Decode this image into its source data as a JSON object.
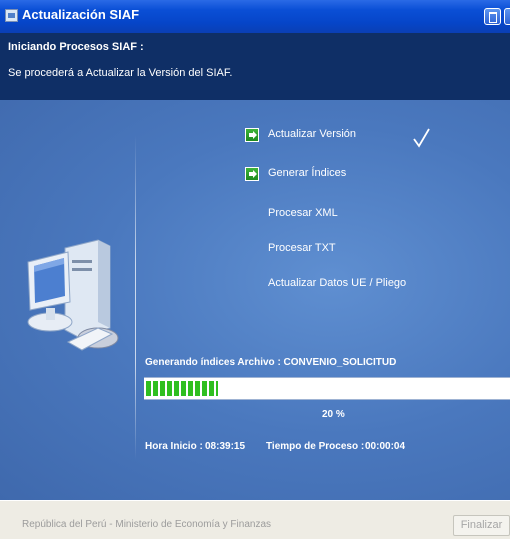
{
  "window": {
    "title": "Actualización SIAF",
    "app_icon": "siaf-app-icon"
  },
  "header": {
    "title": "Iniciando Procesos SIAF :",
    "subtitle": "Se procederá a Actualizar la Versión del SIAF."
  },
  "steps": [
    {
      "label": "Actualizar Versión",
      "icon": "green-arrow-icon",
      "done": true
    },
    {
      "label": "Generar Índices",
      "icon": "green-arrow-icon",
      "done": false
    },
    {
      "label": "Procesar XML"
    },
    {
      "label": "Procesar TXT"
    },
    {
      "label": "Actualizar Datos UE / Pliego"
    }
  ],
  "progress": {
    "caption": "Generando índices Archivo : CONVENIO_SOLICITUD",
    "percent_text": "20 %",
    "value": 0.2,
    "start_label": "Hora Inicio :",
    "start_value": "08:39:15",
    "elapsed_label": "Tiempo de  Proceso :",
    "elapsed_value": "00:00:04"
  },
  "footer": {
    "text": "República del Perú - Ministerio de Economía y Finanzas",
    "finish_label": "Finalizar"
  },
  "colors": {
    "title_bar": "#0a4fd6",
    "header": "#0f2f66",
    "panel": "#4a78be",
    "progress": "#2fbf1f"
  }
}
